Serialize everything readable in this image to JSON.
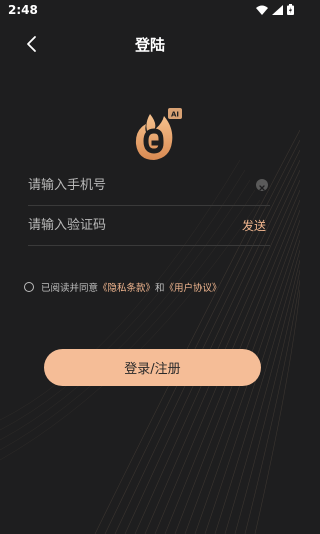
{
  "status_bar": {
    "time": "2:48"
  },
  "header": {
    "title": "登陆"
  },
  "phone_field": {
    "placeholder": "请输入手机号",
    "value": ""
  },
  "code_field": {
    "placeholder": "请输入验证码",
    "value": ""
  },
  "send_button": {
    "label": "发送"
  },
  "agreement": {
    "prefix": "已阅读并同意",
    "privacy_link": "《隐私条款》",
    "conjunction": "和",
    "user_link": "《用户协议》"
  },
  "login_button": {
    "label": "登录/注册"
  },
  "icons": {
    "logo": "brand-logo-icon",
    "back": "back-arrow-icon",
    "clear": "clear-icon"
  },
  "colors": {
    "background": "#1e1e1f",
    "accent": "#f5bd97",
    "link": "#f1b68f"
  }
}
